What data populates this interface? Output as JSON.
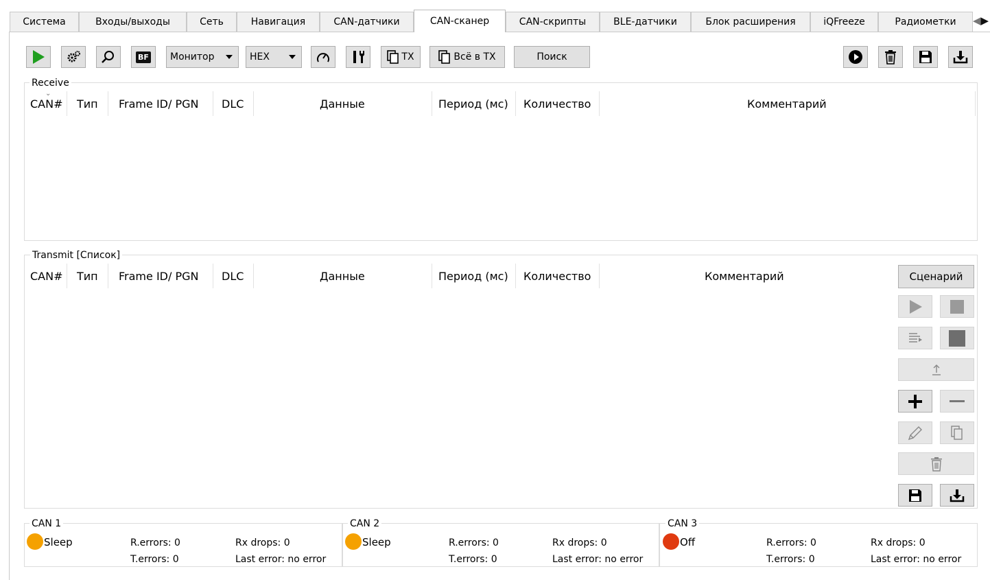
{
  "tabs": [
    {
      "label": "Система"
    },
    {
      "label": "Входы/выходы"
    },
    {
      "label": "Сеть"
    },
    {
      "label": "Навигация"
    },
    {
      "label": "CAN-датчики"
    },
    {
      "label": "CAN-сканер",
      "active": true
    },
    {
      "label": "CAN-скрипты"
    },
    {
      "label": "BLE-датчики"
    },
    {
      "label": "Блок расширения"
    },
    {
      "label": "iQFreeze"
    },
    {
      "label": "Радиометки"
    }
  ],
  "toolbar": {
    "mode_select": "Монитор",
    "format_select": "HEX",
    "bf_label": "BF",
    "tx_label": "TX",
    "all_to_tx_label": "Всё в TX",
    "search_label": "Поиск",
    "play_color": "#1f9e1f"
  },
  "receive": {
    "title": "Receive",
    "columns": [
      "CAN#",
      "Тип",
      "Frame ID/ PGN",
      "DLC",
      "Данные",
      "Период (мс)",
      "Количество",
      "Комментарий"
    ],
    "rows": []
  },
  "transmit": {
    "title": "Transmit [Список]",
    "columns": [
      "CAN#",
      "Тип",
      "Frame ID/ PGN",
      "DLC",
      "Данные",
      "Период (мс)",
      "Количество",
      "Комментарий"
    ],
    "rows": [],
    "scenario_label": "Сценарий"
  },
  "can_status": [
    {
      "title": "CAN 1",
      "state": "Sleep",
      "led_color": "#f5a100",
      "r_errors": "R.errors: 0",
      "t_errors": "T.errors: 0",
      "rx_drops": "Rx drops: 0",
      "last_error": "Last error: no error"
    },
    {
      "title": "CAN 2",
      "state": "Sleep",
      "led_color": "#f5a100",
      "r_errors": "R.errors: 0",
      "t_errors": "T.errors: 0",
      "rx_drops": "Rx drops: 0",
      "last_error": "Last error: no error"
    },
    {
      "title": "CAN 3",
      "state": "Off",
      "led_color": "#e03a10",
      "r_errors": "R.errors: 0",
      "t_errors": "T.errors: 0",
      "rx_drops": "Rx drops: 0",
      "last_error": "Last error: no error"
    }
  ]
}
